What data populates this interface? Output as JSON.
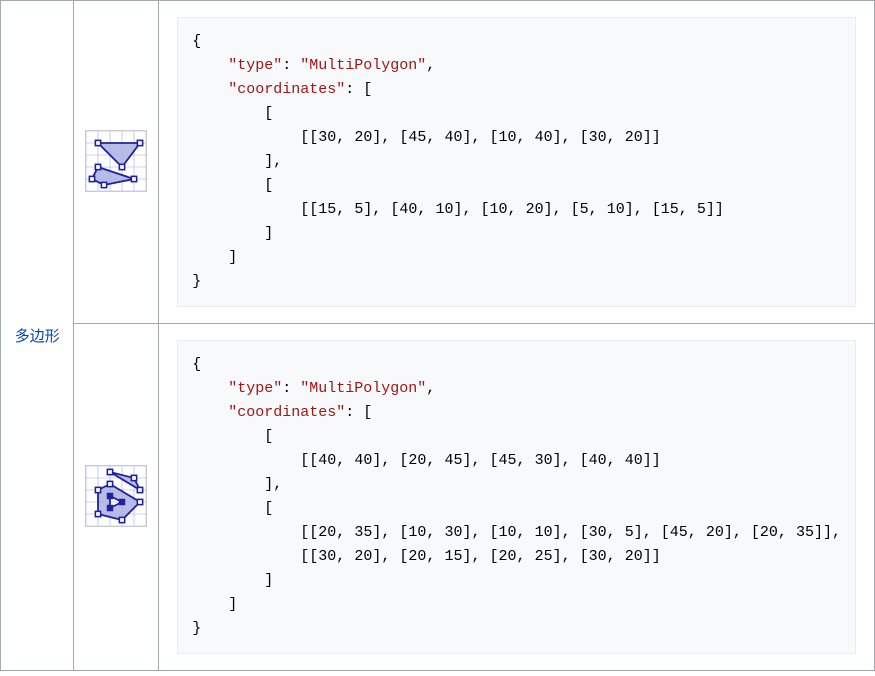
{
  "type_label": "多边形",
  "rows": [
    {
      "code": "{\n    \"type\": \"MultiPolygon\",\n    \"coordinates\": [\n        [\n            [[30, 20], [45, 40], [10, 40], [30, 20]]\n        ],\n        [\n            [[15, 5], [40, 10], [10, 20], [5, 10], [15, 5]]\n        ]\n    ]\n}",
      "geometry": {
        "type": "MultiPolygon",
        "polygons": [
          {
            "rings": [
              [
                [
                  30,
                  20
                ],
                [
                  45,
                  40
                ],
                [
                  10,
                  40
                ],
                [
                  30,
                  20
                ]
              ]
            ]
          },
          {
            "rings": [
              [
                [
                  15,
                  5
                ],
                [
                  40,
                  10
                ],
                [
                  10,
                  20
                ],
                [
                  5,
                  10
                ],
                [
                  15,
                  5
                ]
              ]
            ]
          }
        ]
      }
    },
    {
      "code": "{\n    \"type\": \"MultiPolygon\",\n    \"coordinates\": [\n        [\n            [[40, 40], [20, 45], [45, 30], [40, 40]]\n        ],\n        [\n            [[20, 35], [10, 30], [10, 10], [30, 5], [45, 20], [20, 35]],\n            [[30, 20], [20, 15], [20, 25], [30, 20]]\n        ]\n    ]\n}",
      "geometry": {
        "type": "MultiPolygon",
        "polygons": [
          {
            "rings": [
              [
                [
                  40,
                  40
                ],
                [
                  20,
                  45
                ],
                [
                  45,
                  30
                ],
                [
                  40,
                  40
                ]
              ]
            ]
          },
          {
            "rings": [
              [
                [
                  20,
                  35
                ],
                [
                  10,
                  30
                ],
                [
                  10,
                  10
                ],
                [
                  30,
                  5
                ],
                [
                  45,
                  20
                ],
                [
                  20,
                  35
                ]
              ],
              [
                [
                  30,
                  20
                ],
                [
                  20,
                  15
                ],
                [
                  20,
                  25
                ],
                [
                  30,
                  20
                ]
              ]
            ]
          }
        ]
      }
    }
  ]
}
